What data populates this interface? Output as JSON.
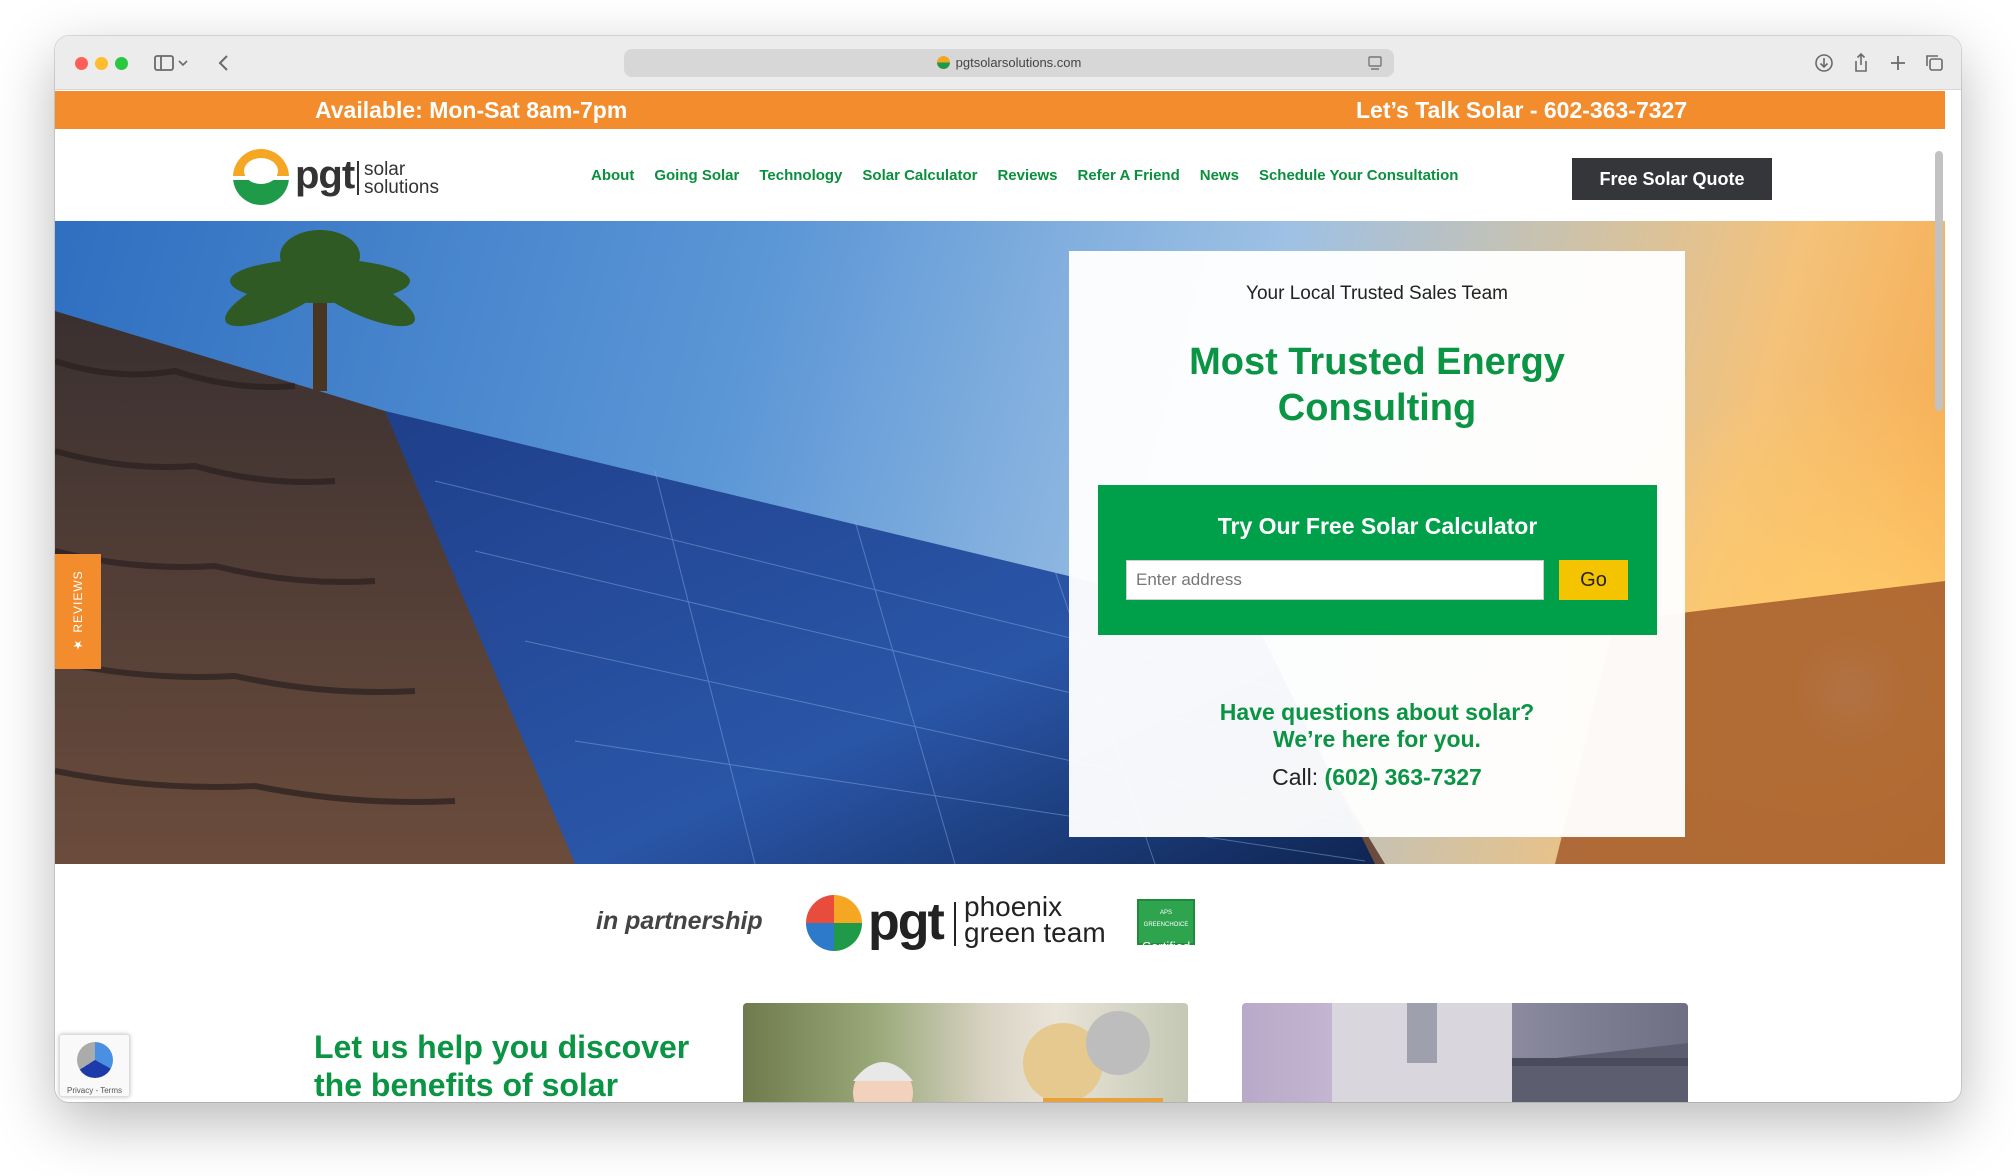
{
  "browser": {
    "url": "pgtsolarsolutions.com"
  },
  "topbar": {
    "hours": "Available: Mon-Sat 8am-7pm",
    "phone": "Let’s Talk Solar - 602-363-7327"
  },
  "header": {
    "logo_brand": "pgt",
    "logo_sub1": "solar",
    "logo_sub2": "solutions",
    "nav": [
      {
        "label": "About"
      },
      {
        "label": "Going Solar"
      },
      {
        "label": "Technology"
      },
      {
        "label": "Solar Calculator"
      },
      {
        "label": "Reviews"
      },
      {
        "label": "Refer A Friend"
      },
      {
        "label": "News"
      },
      {
        "label": "Schedule Your Consultation"
      }
    ],
    "cta_label": "Free Solar Quote"
  },
  "reviews_tab": "★ REVIEWS",
  "hero_card": {
    "kicker": "Your Local Trusted Sales Team",
    "title": "Most Trusted Energy Consulting",
    "calculator": {
      "title": "Try Our Free Solar Calculator",
      "placeholder": "Enter address",
      "button": "Go"
    },
    "questions_line1": "Have questions about solar?",
    "questions_line2": "We’re here for you.",
    "call_label": "Call:",
    "call_number": "(602) 363-7327"
  },
  "partnership": {
    "label": "in partnership",
    "brand": "pgt",
    "sub1": "phoenix",
    "sub2": "green team",
    "badge_top": "APS GREENCHOICE",
    "badge_bottom": "Certified"
  },
  "benefits": {
    "heading": "Let us help you discover the benefits of solar"
  },
  "recaptcha": {
    "text": "Privacy - Terms"
  },
  "colors": {
    "orange": "#f28c2c",
    "green": "#0a9444",
    "calc_green": "#00a04a",
    "go_yellow": "#f5c400",
    "dark_button": "#35363a"
  }
}
